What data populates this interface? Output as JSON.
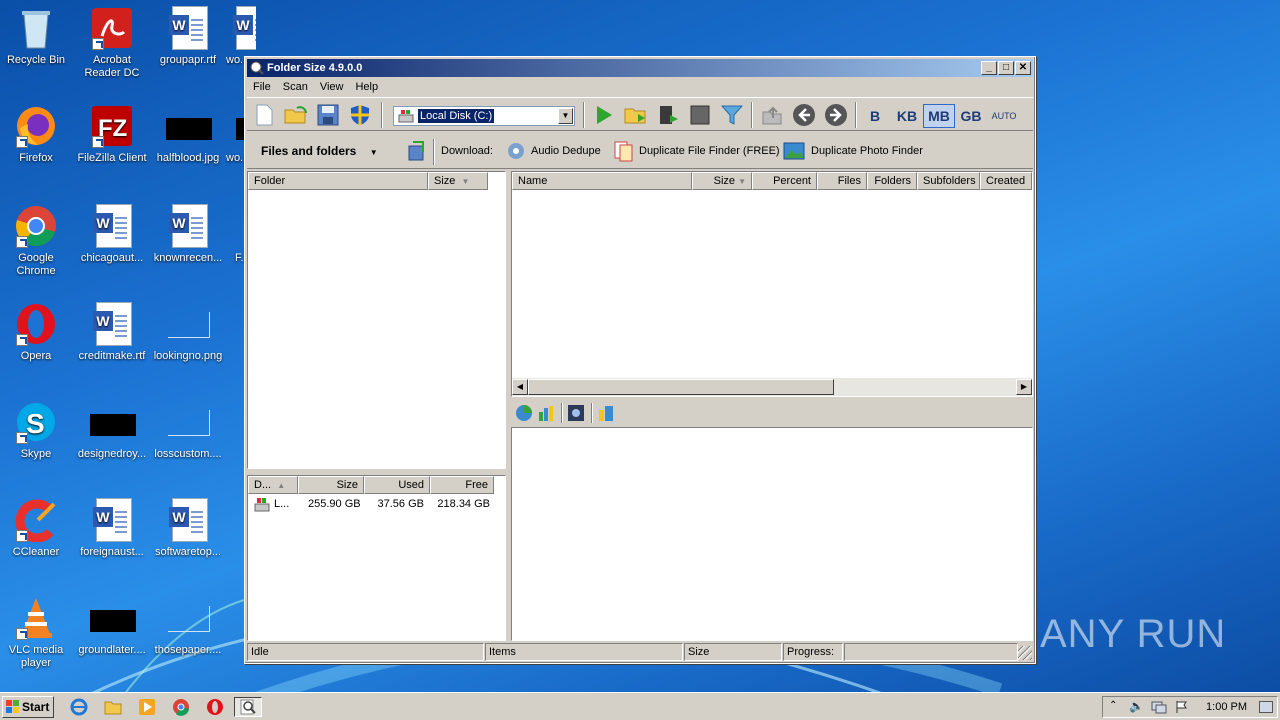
{
  "desktop": {
    "icons": [
      {
        "label": "Recycle Bin"
      },
      {
        "label": "Acrobat Reader DC"
      },
      {
        "label": "groupapr.rtf"
      },
      {
        "label": "wo..."
      },
      {
        "label": "Firefox"
      },
      {
        "label": "FileZilla Client"
      },
      {
        "label": "halfblood.jpg"
      },
      {
        "label": "wo..."
      },
      {
        "label": "Google Chrome"
      },
      {
        "label": "chicagoaut..."
      },
      {
        "label": "knownrecen..."
      },
      {
        "label": "F..."
      },
      {
        "label": "Opera"
      },
      {
        "label": "creditmake.rtf"
      },
      {
        "label": "lookingno.png"
      },
      {
        "label": "Skype"
      },
      {
        "label": "designedroy..."
      },
      {
        "label": "losscustom...."
      },
      {
        "label": "CCleaner"
      },
      {
        "label": "foreignaust..."
      },
      {
        "label": "softwaretop..."
      },
      {
        "label": "VLC media player"
      },
      {
        "label": "groundlater...."
      },
      {
        "label": "thosepaper...."
      }
    ],
    "watermark": "ANY RUN"
  },
  "window": {
    "title": "Folder Size 4.9.0.0",
    "menu": [
      "File",
      "Scan",
      "View",
      "Help"
    ],
    "drive_select": {
      "value": "Local Disk (C:)"
    },
    "units": [
      "B",
      "KB",
      "MB",
      "GB",
      "AUTO"
    ],
    "active_unit": "MB",
    "toolbar2": {
      "view_mode": "Files and folders",
      "download_label": "Download:",
      "links": [
        "Audio Dedupe",
        "Duplicate File Finder (FREE)",
        "Duplicate Photo Finder"
      ]
    },
    "folder_tree": {
      "headers": [
        "Folder",
        "Size"
      ]
    },
    "file_list": {
      "headers": [
        "Name",
        "Size",
        "Percent",
        "Files",
        "Folders",
        "Subfolders",
        "Created"
      ]
    },
    "drives": {
      "headers": [
        "D...",
        "Size",
        "Used",
        "Free"
      ],
      "rows": [
        {
          "name": "L...",
          "size": "255.90 GB",
          "used": "37.56 GB",
          "free": "218.34 GB"
        }
      ]
    },
    "status": {
      "state": "Idle",
      "items": "Items",
      "size": "Size",
      "progress": "Progress:"
    }
  },
  "taskbar": {
    "start": "Start",
    "clock": "1:00 PM"
  },
  "colors": {
    "title_start": "#0a246a",
    "title_end": "#a6caf0",
    "desktop": "#1c73d3"
  }
}
